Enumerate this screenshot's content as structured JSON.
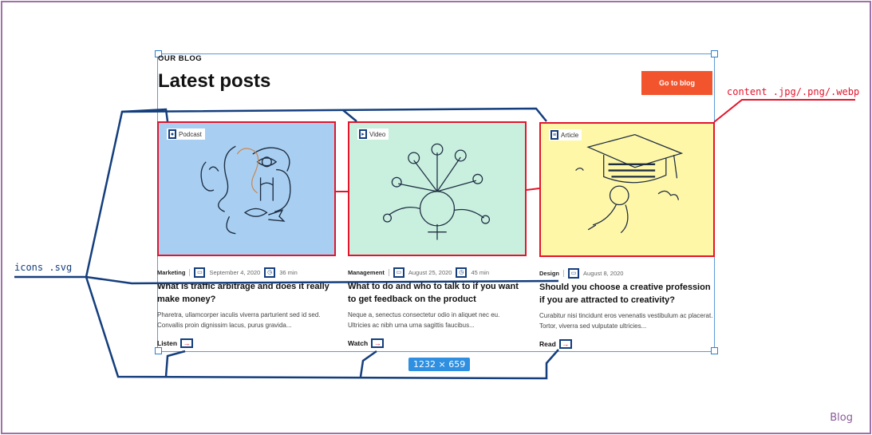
{
  "blog": {
    "eyebrow": "OUR BLOG",
    "title": "Latest posts",
    "cta": "Go to blog"
  },
  "posts": [
    {
      "type": "Podcast",
      "type_icon": "microphone-icon",
      "thumb_color": "#a8cff2",
      "category": "Marketing",
      "date": "September 4, 2020",
      "duration": "36 min",
      "title": "What is traffic arbitrage and does it really make money?",
      "excerpt": "Pharetra, ullamcorper iaculis viverra parturient sed id sed. Convallis proin dignissim lacus, purus gravida...",
      "action": "Listen"
    },
    {
      "type": "Video",
      "type_icon": "play-circle-icon",
      "thumb_color": "#c9f0df",
      "category": "Management",
      "date": "August 25, 2020",
      "duration": "45 min",
      "title": "What to do and who to talk to if you want to get feedback on the product",
      "excerpt": "Neque a, senectus consectetur odio in aliquet nec eu. Ultricies ac nibh urna urna sagittis faucibus...",
      "action": "Watch"
    },
    {
      "type": "Article",
      "type_icon": "document-icon",
      "thumb_color": "#fff7a8",
      "category": "Design",
      "date": "August 8, 2020",
      "duration": "",
      "title": "Should you choose a creative profession if you are attracted to creativity?",
      "excerpt": "Curabitur nisi tincidunt eros venenatis vestibulum ac placerat. Tortor, viverra sed vulputate ultricies...",
      "action": "Read"
    }
  ],
  "annotations": {
    "icons": "icons .svg",
    "content": "content .jpg/.png/.webp",
    "size": "1232 × 659",
    "frame": "Blog"
  },
  "colors": {
    "accent": "#f2542d",
    "annotation_blue": "#143e7d",
    "annotation_red": "#e3142b"
  }
}
